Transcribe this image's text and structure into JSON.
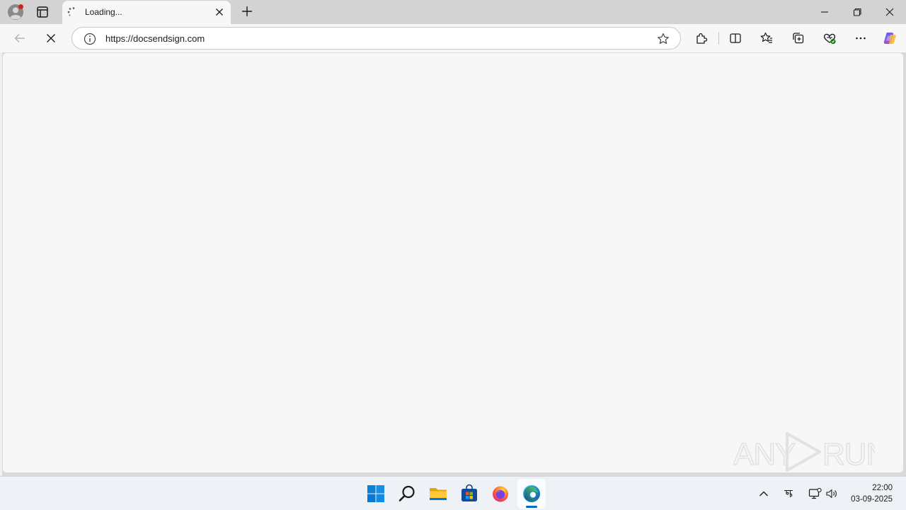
{
  "browser": {
    "tab": {
      "title": "Loading..."
    },
    "address_bar": {
      "url": "https://docsendsign.com"
    }
  },
  "watermark": {
    "text": "ANY RUN"
  },
  "taskbar": {
    "apps": [
      "start-icon",
      "search-icon",
      "file-explorer-icon",
      "store-icon",
      "firefox-icon",
      "edge-icon"
    ],
    "clock": {
      "time": "22:00",
      "date": "03-09-2025"
    }
  },
  "colors": {
    "accent": "#0067c0",
    "content_bg": "#f7f7f7",
    "tabbar_bg": "#d3d3d3"
  }
}
